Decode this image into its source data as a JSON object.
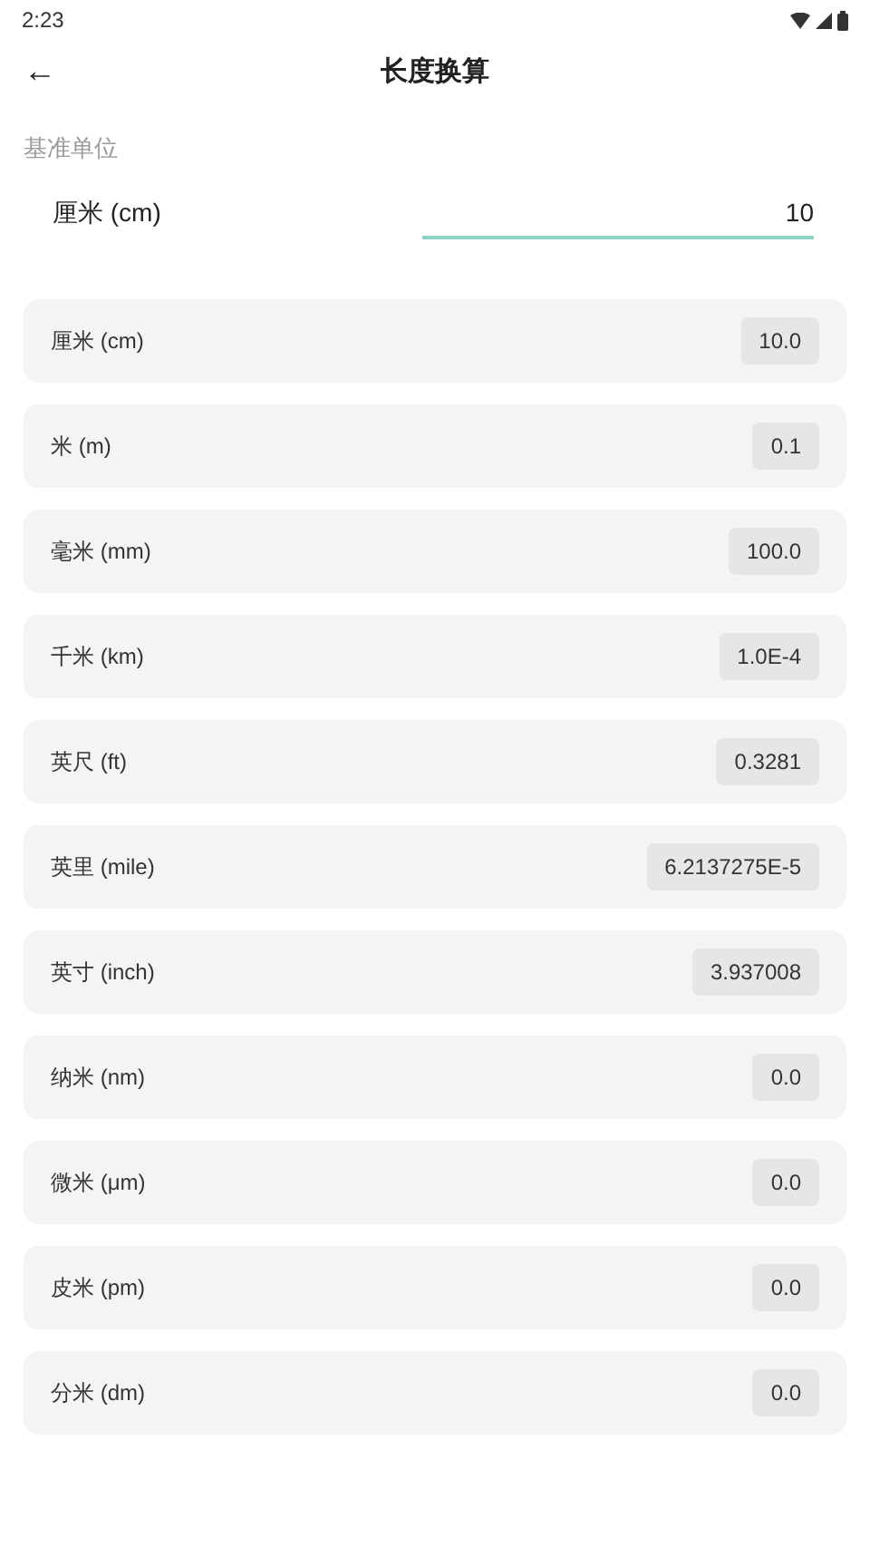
{
  "status_bar": {
    "time": "2:23"
  },
  "app_bar": {
    "back": "←",
    "title": "长度换算"
  },
  "base_unit": {
    "label": "基准单位",
    "unit": "厘米 (cm)",
    "value": "10"
  },
  "results": [
    {
      "unit": "厘米 (cm)",
      "value": "10.0"
    },
    {
      "unit": "米 (m)",
      "value": "0.1"
    },
    {
      "unit": "毫米 (mm)",
      "value": "100.0"
    },
    {
      "unit": "千米 (km)",
      "value": "1.0E-4"
    },
    {
      "unit": "英尺 (ft)",
      "value": "0.3281"
    },
    {
      "unit": "英里 (mile)",
      "value": "6.2137275E-5"
    },
    {
      "unit": "英寸 (inch)",
      "value": "3.937008"
    },
    {
      "unit": "纳米 (nm)",
      "value": "0.0"
    },
    {
      "unit": "微米 (μm)",
      "value": "0.0"
    },
    {
      "unit": "皮米 (pm)",
      "value": "0.0"
    },
    {
      "unit": "分米 (dm)",
      "value": "0.0"
    }
  ]
}
